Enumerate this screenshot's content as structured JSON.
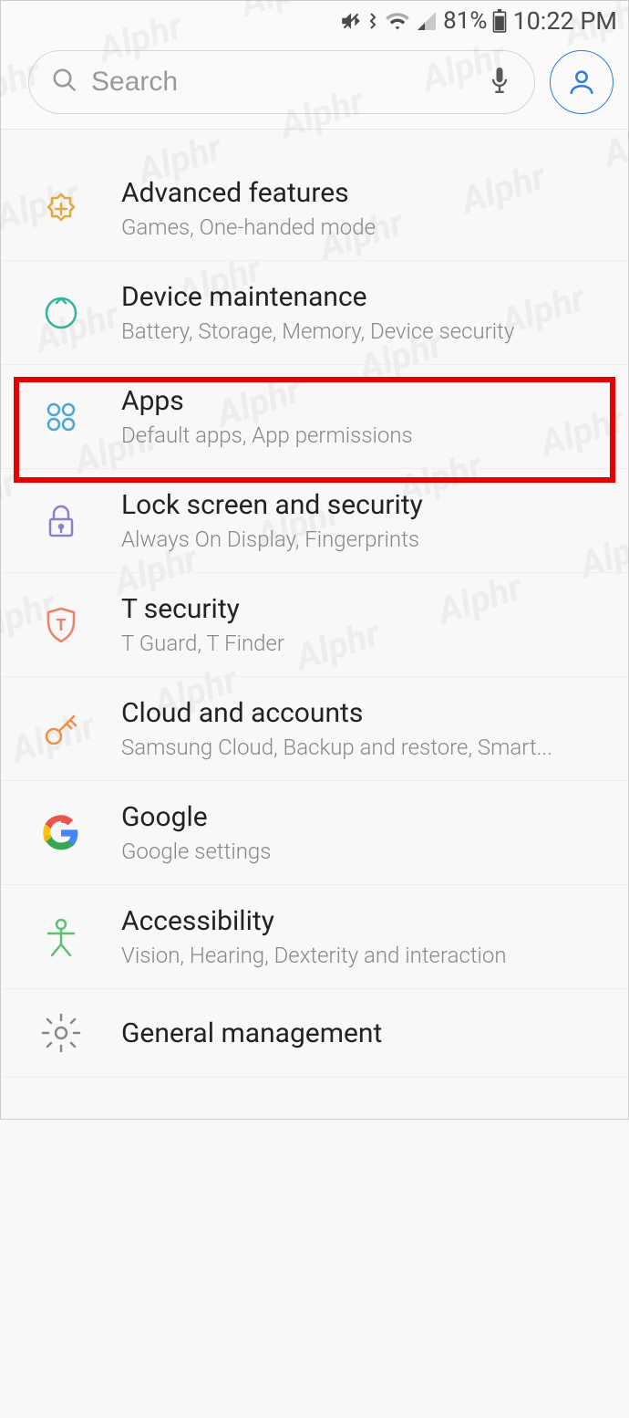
{
  "status": {
    "battery": "81%",
    "time": "10:22 PM"
  },
  "search": {
    "placeholder": "Search"
  },
  "items": [
    {
      "id": "advanced-features",
      "title": "Advanced features",
      "subtitle": "Games, One-handed mode",
      "icon": "plus-gear",
      "color": "#e0a93a"
    },
    {
      "id": "device-maintenance",
      "title": "Device maintenance",
      "subtitle": "Battery, Storage, Memory, Device security",
      "icon": "cycle",
      "color": "#35b597"
    },
    {
      "id": "apps",
      "title": "Apps",
      "subtitle": "Default apps, App permissions",
      "icon": "four-dots",
      "color": "#4aa6d8"
    },
    {
      "id": "lock-screen-security",
      "title": "Lock screen and security",
      "subtitle": "Always On Display, Fingerprints",
      "icon": "lock",
      "color": "#8d7fd0"
    },
    {
      "id": "t-security",
      "title": "T security",
      "subtitle": "T Guard, T Finder",
      "icon": "shield-t",
      "color": "#f08060"
    },
    {
      "id": "cloud-accounts",
      "title": "Cloud and accounts",
      "subtitle": "Samsung Cloud, Backup and restore, Smart...",
      "icon": "key",
      "color": "#f09048"
    },
    {
      "id": "google",
      "title": "Google",
      "subtitle": "Google settings",
      "icon": "google-g",
      "color": "#4285f4"
    },
    {
      "id": "accessibility",
      "title": "Accessibility",
      "subtitle": "Vision, Hearing, Dexterity and interaction",
      "icon": "person",
      "color": "#5cc070"
    },
    {
      "id": "general-management",
      "title": "General management",
      "subtitle": "",
      "icon": "gear",
      "color": "#888"
    }
  ],
  "highlighted_item_index": 2
}
